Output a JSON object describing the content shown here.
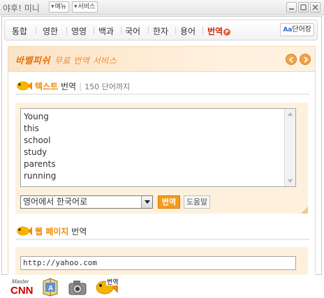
{
  "window": {
    "title": "야후! 미니",
    "menu_label": "메뉴",
    "service_label": "서비스"
  },
  "nav": {
    "tabs": [
      {
        "label": "통합"
      },
      {
        "label": "영한"
      },
      {
        "label": "영영"
      },
      {
        "label": "백과"
      },
      {
        "label": "국어"
      },
      {
        "label": "한자"
      },
      {
        "label": "용어"
      },
      {
        "label": "번역",
        "badge": "P"
      }
    ],
    "wordbook_prefix": "Aa",
    "wordbook_label": "단어장"
  },
  "banner": {
    "title": "바벨피쉬",
    "subtitle": "무료 번역 서비스"
  },
  "text_section": {
    "highlight": "텍스트",
    "label": "번역",
    "limit": "150 단어까지",
    "lines": [
      "Young",
      "this",
      "school",
      "study",
      "parents",
      "running"
    ],
    "language_select": "영어에서 한국어로",
    "translate_button": "번역",
    "help_button": "도움말"
  },
  "web_section": {
    "highlight": "웹 페이지",
    "label": "번역",
    "url_value": "http://yahoo.com"
  },
  "bottom_toolbar": {
    "babelfish_badge": "번역",
    "master_label": "Master",
    "cnn_label": "CNN",
    "dict_label": "A"
  },
  "colors": {
    "accent": "#f08a00",
    "active_tab": "#cc2200",
    "panel_bg": "#fdf1de"
  }
}
